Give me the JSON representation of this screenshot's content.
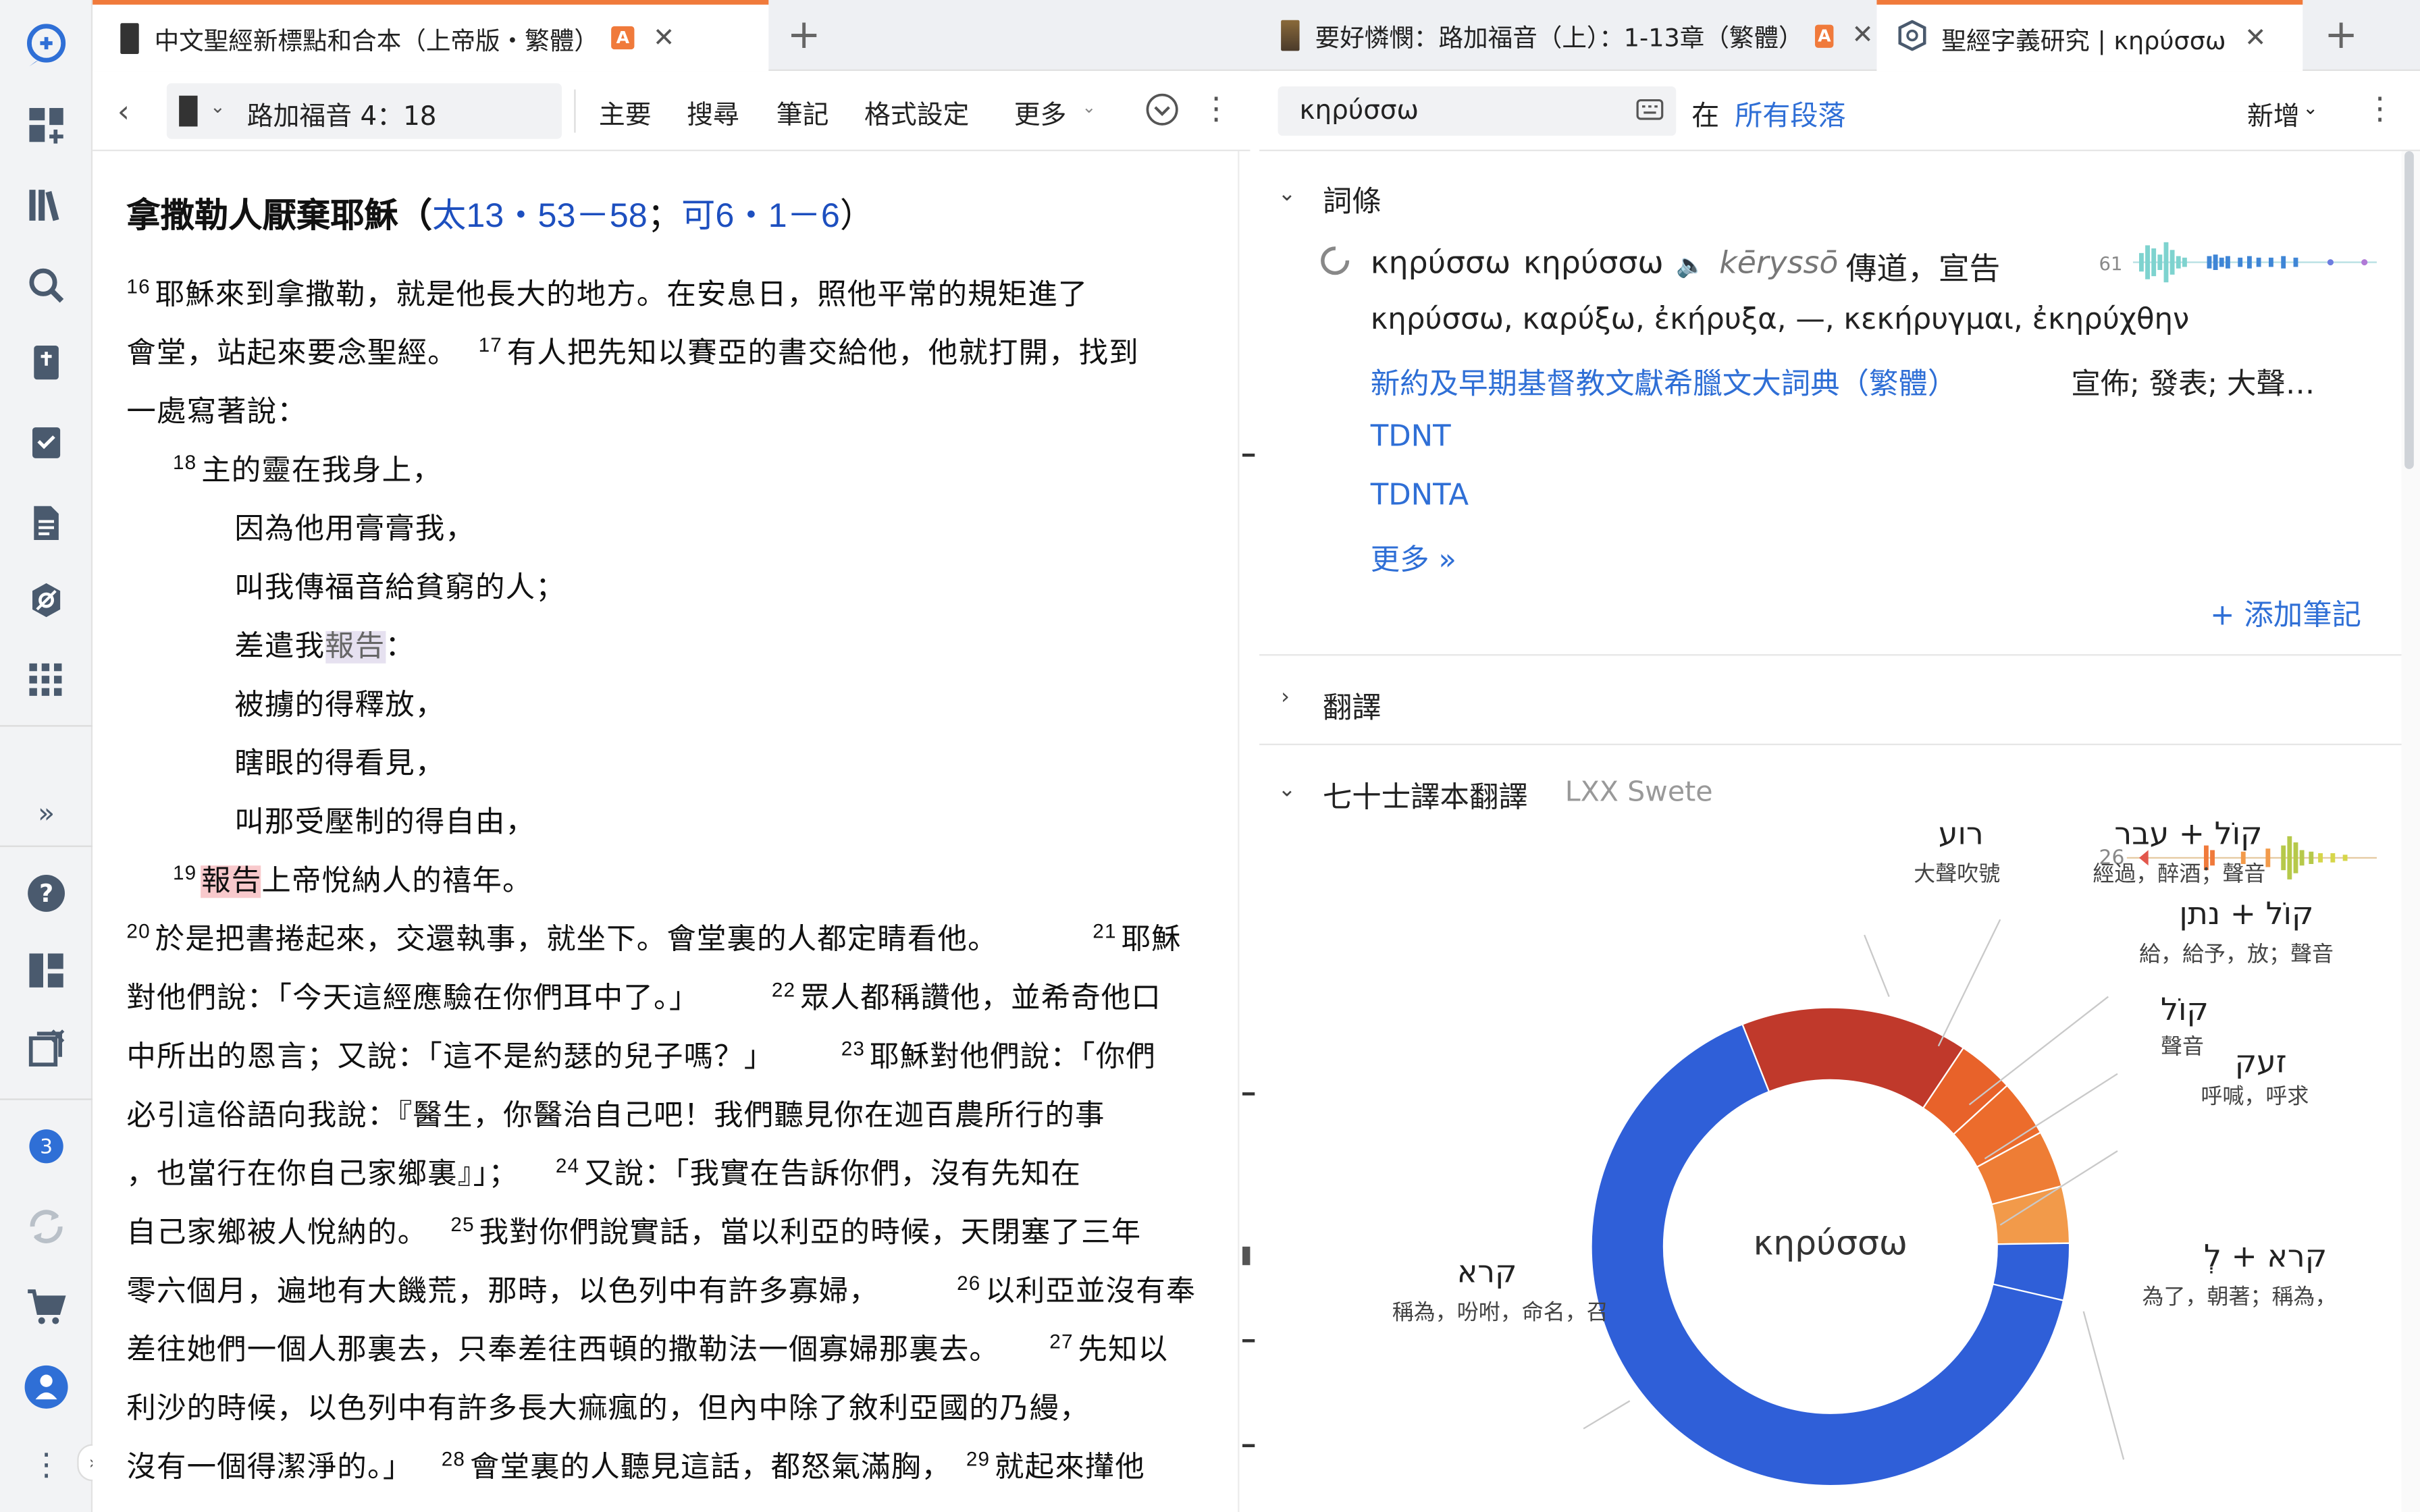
{
  "tabs": [
    {
      "title": "中文聖經新標點和合本（上帝版・繁體）",
      "badge": "A"
    },
    {
      "title": "要好憐憫：路加福音（上）：1-13章（繁體）",
      "badge": "A"
    },
    {
      "title": "聖經字義研究 | κηρύσσω"
    }
  ],
  "left_toolbar": {
    "reference": "路加福音 4：18",
    "menu": [
      "主要",
      "搜尋",
      "筆記",
      "格式設定",
      "更多"
    ]
  },
  "passage": {
    "heading": "拿撒勒人厭棄耶穌（",
    "heading_ref1": "太13・53－58",
    "heading_sep": "；",
    "heading_ref2": "可6・1－6",
    "heading_end": "）",
    "lines": [
      {
        "n": "16",
        "t": "耶穌來到拿撒勒，就是他長大的地方。在安息日，照他平常的規矩進了"
      },
      {
        "t": "會堂，站起來要念聖經。"
      },
      {
        "n": "17",
        "t": "有人把先知以賽亞的書交給他，他就打開，找到"
      },
      {
        "t": "一處寫著說："
      },
      {
        "n": "18",
        "t": "主的靈在我身上，"
      },
      {
        "t": "因為他用膏膏我，"
      },
      {
        "t": "叫我傳福音給貧窮的人；"
      },
      {
        "t": "差遣我",
        "hl": "報告",
        "t2": "："
      },
      {
        "t": "被擄的得釋放，"
      },
      {
        "t": "瞎眼的得看見，"
      },
      {
        "t": "叫那受壓制的得自由，"
      },
      {
        "n": "19",
        "hl": "報告",
        "t": "上帝悅納人的禧年。"
      },
      {
        "n": "20",
        "t": "於是把書捲起來，交還執事，就坐下。會堂裏的人都定睛看他。"
      },
      {
        "n": "21",
        "t": "耶穌"
      },
      {
        "t": "對他們說：「今天這經應驗在你們耳中了。」"
      },
      {
        "n": "22",
        "t": "眾人都稱讚他，並希奇他口"
      },
      {
        "t": "中所出的恩言；又說：「這不是約瑟的兒子嗎？」"
      },
      {
        "n": "23",
        "t": "耶穌對他們說：「你們"
      },
      {
        "t": "必引這俗語向我說：『醫生，你醫治自己吧！我們聽見你在迦百農所行的事"
      },
      {
        "t": "，也當行在你自己家鄉裏』」；"
      },
      {
        "n": "24",
        "t": "又說：「我實在告訴你們，沒有先知在"
      },
      {
        "t": "自己家鄉被人悅納的。"
      },
      {
        "n": "25",
        "t": "我對你們說實話，當以利亞的時候，天閉塞了三年"
      },
      {
        "t": "零六個月，遍地有大饑荒，那時，以色列中有許多寡婦，"
      },
      {
        "n": "26",
        "t": "以利亞並沒有奉"
      },
      {
        "t": "差往她們一個人那裏去，只奉差往西頓的撒勒法一個寡婦那裏去。"
      },
      {
        "n": "27",
        "t": "先知以"
      },
      {
        "t": "利沙的時候，以色列中有許多長大痲瘋的，但內中除了敘利亞國的乃縵，"
      },
      {
        "t": "沒有一個得潔淨的。」"
      },
      {
        "n": "28",
        "t": "會堂裏的人聽見這話，都怒氣滿胸，"
      },
      {
        "n": "29",
        "t": "就起來攆他"
      }
    ]
  },
  "right_toolbar": {
    "search_value": "κηρύσσω",
    "in_label": "在",
    "scope": "所有段落",
    "new_label": "新增"
  },
  "entry": {
    "section_title": "詞條",
    "lemma": "κηρύσσω",
    "lemma2": "κηρύσσω",
    "translit": "kēryssō",
    "gloss": "傳道，宣告",
    "count": "61",
    "forms": "κηρύσσω, καρύξω, ἐκήρυξα, —, κεκήρυγμαι, ἐκηρύχθην",
    "dict_link": "新約及早期基督教文獻希臘文大詞典（繁體）",
    "dict_gloss": "宣佈; 發表; 大聲…",
    "links": [
      "TDNT",
      "TDNTA",
      "更多 »"
    ],
    "add_note": "+ 添加筆記"
  },
  "translation_section": {
    "title": "翻譯"
  },
  "lxx": {
    "title": "七十士譯本翻譯",
    "subtitle": "LXX Swete",
    "count": "26",
    "center_label": "κηρύσσω"
  },
  "chart_data": {
    "type": "pie",
    "title": "七十士譯本翻譯",
    "center_label": "κηρύσσω",
    "slices": [
      {
        "label": "קרא",
        "gloss": "稱為，吩咐，命名，召",
        "value": 17,
        "color": "#2f5fd8"
      },
      {
        "label": "רוע",
        "gloss": "大聲吹號",
        "value": 4,
        "color": "#c0392b"
      },
      {
        "label": "קוֹל + עבר",
        "gloss": "經過，醉酒；聲音",
        "value": 1,
        "color": "#e8622a"
      },
      {
        "label": "קוֹל + נתן",
        "gloss": "給，給予，放；聲音",
        "value": 1,
        "color": "#ec6c2c"
      },
      {
        "label": "קוֹל",
        "gloss": "聲音",
        "value": 1,
        "color": "#ee7d35"
      },
      {
        "label": "זעק",
        "gloss": "呼喊，呼求",
        "value": 1,
        "color": "#f29a4a"
      },
      {
        "label": "קרא + לְ",
        "gloss": "為了，朝著；稱為，",
        "value": 1,
        "color": "#2f5fd8"
      }
    ]
  }
}
